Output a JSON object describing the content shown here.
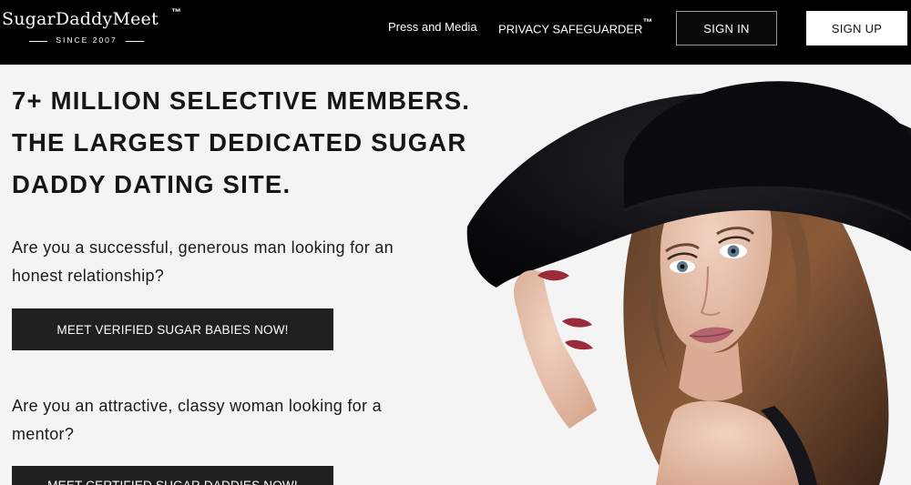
{
  "header": {
    "logo": {
      "name": "SugarDaddyMeet",
      "tm": "™",
      "since": "SINCE 2007"
    },
    "nav": {
      "press": "Press and Media",
      "privacy": "PRIVACY SAFEGUARDER",
      "privacy_tm": "™"
    },
    "sign_in": "SIGN IN",
    "sign_up": "SIGN UP"
  },
  "hero": {
    "headline": [
      "7+ MILLION SELECTIVE MEMBERS.",
      "THE LARGEST DEDICATED SUGAR",
      "DADDY DATING SITE."
    ],
    "men_question": "Are you a successful, generous man looking for an honest relationship?",
    "men_cta": "MEET VERIFIED SUGAR BABIES NOW!",
    "women_question": "Are you an attractive, classy woman looking for a mentor?",
    "women_cta": "MEET CERTIFIED SUGAR DADDIES NOW!"
  },
  "colors": {
    "header_bg": "#000000",
    "page_bg": "#f4f4f4",
    "cta_bg": "#202020"
  }
}
